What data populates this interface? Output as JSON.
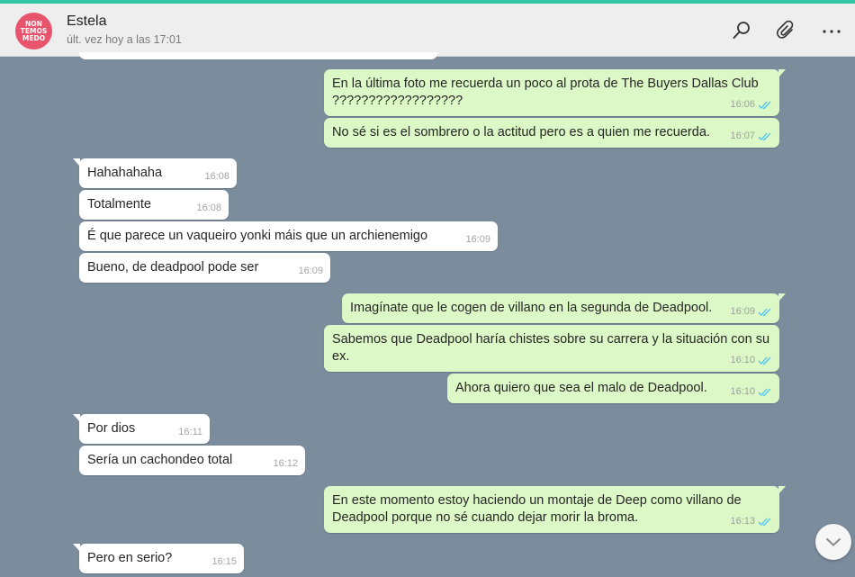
{
  "header": {
    "avatar_text": "NON TEMOS MEDO",
    "contact_name": "Estela",
    "last_seen": "últ. vez hoy a las 17:01"
  },
  "messages": [
    {
      "dir": "out",
      "text": "En la última foto me recuerda un poco al prota de The Buyers Dallas Club ??????????????????",
      "time": "16:06",
      "ticks": true,
      "tail": true
    },
    {
      "dir": "out",
      "text": "No sé si es el sombrero o la actitud pero es a quien me recuerda.",
      "time": "16:07",
      "ticks": true,
      "tail": false
    },
    {
      "dir": "in",
      "text": "Hahahahaha",
      "time": "16:08",
      "tail": true
    },
    {
      "dir": "in",
      "text": "Totalmente",
      "time": "16:08",
      "tail": false
    },
    {
      "dir": "in",
      "text": "É que parece un vaqueiro yonki máis que un archienemigo",
      "time": "16:09",
      "tail": false
    },
    {
      "dir": "in",
      "text": "Bueno, de deadpool pode ser",
      "time": "16:09",
      "tail": false
    },
    {
      "dir": "out",
      "text": "Imagínate que le cogen de villano en la segunda de Deadpool.",
      "time": "16:09",
      "ticks": true,
      "tail": true
    },
    {
      "dir": "out",
      "text": "Sabemos que Deadpool haría chistes sobre su carrera y la situación con su ex.",
      "time": "16:10",
      "ticks": true,
      "tail": false
    },
    {
      "dir": "out",
      "text": "Ahora quiero que sea el malo de Deadpool.",
      "time": "16:10",
      "ticks": true,
      "tail": false
    },
    {
      "dir": "in",
      "text": "Por dios",
      "time": "16:11",
      "tail": true
    },
    {
      "dir": "in",
      "text": "Sería un cachondeo total",
      "time": "16:12",
      "tail": false
    },
    {
      "dir": "out",
      "text": "En este momento estoy haciendo un montaje de Deep como villano de Deadpool porque no sé cuando dejar morir la broma.",
      "time": "16:13",
      "ticks": true,
      "tail": true
    },
    {
      "dir": "in",
      "text": "Pero en serio?",
      "time": "16:15",
      "tail": true
    }
  ],
  "icons": {
    "search": "search-icon",
    "attach": "paperclip-icon",
    "menu": "more-options-icon",
    "scroll": "chevron-down-icon",
    "read_receipt": "double-check-icon"
  },
  "colors": {
    "accent": "#33c7a6",
    "chat_background": "#7b8c9d",
    "outgoing_bubble": "#dcf8c6",
    "incoming_bubble": "#ffffff",
    "read_ticks": "#4fc3f7"
  }
}
